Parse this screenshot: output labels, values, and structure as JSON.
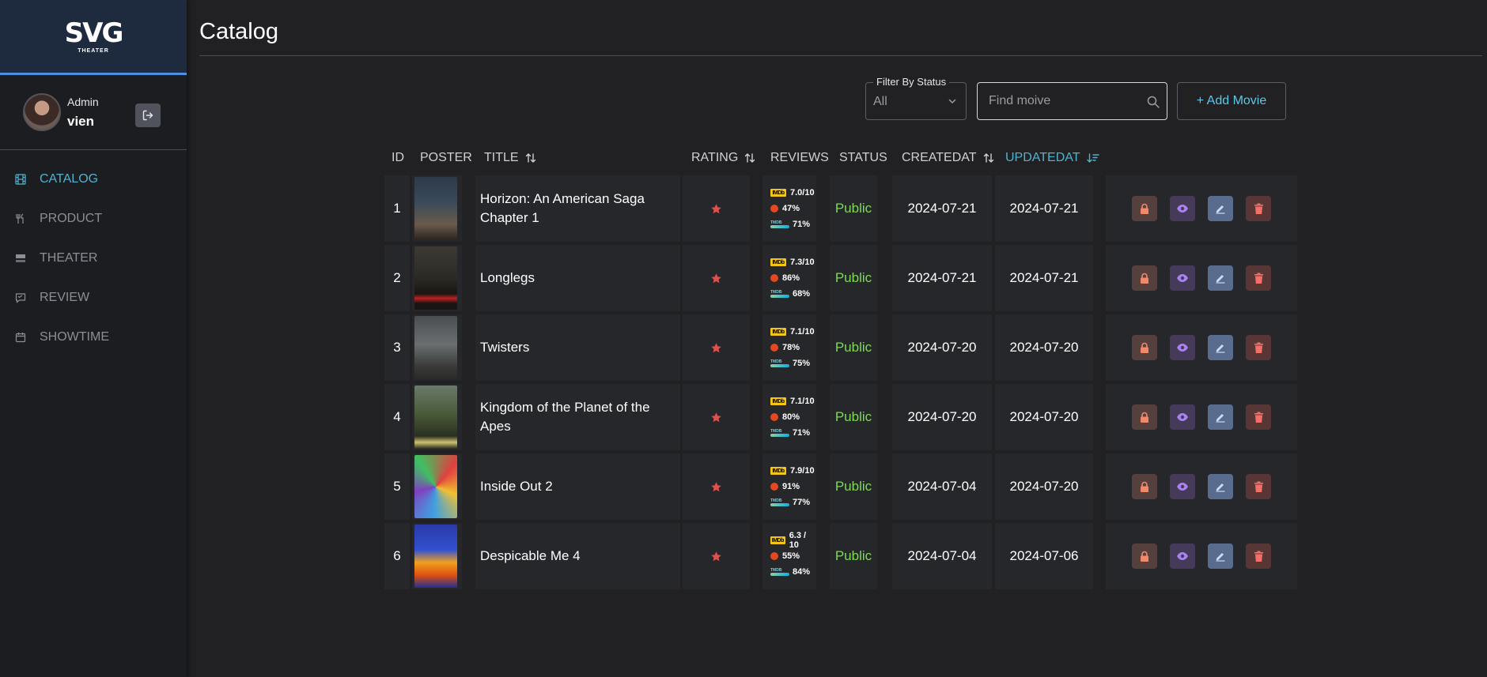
{
  "brand": {
    "logo_main": "SVG",
    "logo_sub": "THEATER"
  },
  "user": {
    "role": "Admin",
    "name": "vien"
  },
  "nav": [
    {
      "label": "CATALOG",
      "icon": "film-icon",
      "active": true
    },
    {
      "label": "PRODUCT",
      "icon": "utensils-icon",
      "active": false
    },
    {
      "label": "THEATER",
      "icon": "theater-icon",
      "active": false
    },
    {
      "label": "REVIEW",
      "icon": "review-icon",
      "active": false
    },
    {
      "label": "SHOWTIME",
      "icon": "calendar-icon",
      "active": false
    }
  ],
  "page": {
    "title": "Catalog"
  },
  "filter": {
    "label": "Filter By Status",
    "value": "All"
  },
  "search": {
    "placeholder": "Find moive"
  },
  "add_button": {
    "label": "+ Add Movie"
  },
  "columns": [
    "ID",
    "POSTER",
    "TITLE",
    "RATING",
    "REVIEWS",
    "STATUS",
    "CREATEDAT",
    "UPDATEDAT"
  ],
  "movies": [
    {
      "id": "1",
      "title": "Horizon: An American Saga Chapter 1",
      "imdb": "7.0/10",
      "tomato": "47%",
      "tmdb": "71%",
      "status": "Public",
      "created": "2024-07-21",
      "updated": "2024-07-21"
    },
    {
      "id": "2",
      "title": "Longlegs",
      "imdb": "7.3/10",
      "tomato": "86%",
      "tmdb": "68%",
      "status": "Public",
      "created": "2024-07-21",
      "updated": "2024-07-21"
    },
    {
      "id": "3",
      "title": "Twisters",
      "imdb": "7.1/10",
      "tomato": "78%",
      "tmdb": "75%",
      "status": "Public",
      "created": "2024-07-20",
      "updated": "2024-07-20"
    },
    {
      "id": "4",
      "title": "Kingdom of the Planet of the Apes",
      "imdb": "7.1/10",
      "tomato": "80%",
      "tmdb": "71%",
      "status": "Public",
      "created": "2024-07-20",
      "updated": "2024-07-20"
    },
    {
      "id": "5",
      "title": "Inside Out 2",
      "imdb": "7.9/10",
      "tomato": "91%",
      "tmdb": "77%",
      "status": "Public",
      "created": "2024-07-04",
      "updated": "2024-07-20"
    },
    {
      "id": "6",
      "title": "Despicable Me 4",
      "imdb": "6.3 / 10",
      "tomato": "55%",
      "tmdb": "84%",
      "status": "Public",
      "created": "2024-07-04",
      "updated": "2024-07-06"
    }
  ],
  "review_logos": {
    "imdb": "IMDb",
    "tmdb": "TMDB"
  },
  "colors": {
    "accent": "#4fb3cf",
    "status_public": "#7fd858",
    "star": "#e0504a"
  }
}
